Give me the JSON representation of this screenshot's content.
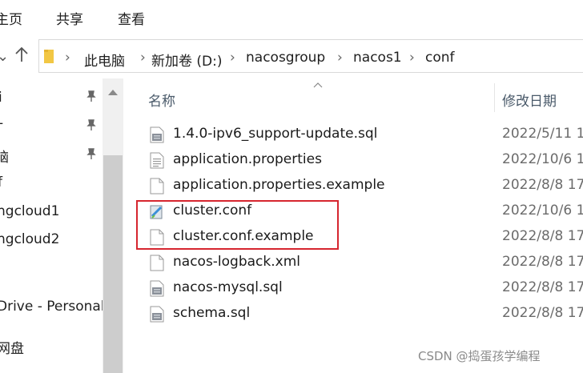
{
  "ribbon": {
    "tabs": [
      "主页",
      "共享",
      "查看"
    ]
  },
  "address": {
    "crumbs": [
      "此电脑",
      "新加卷 (D:)",
      "nacosgroup",
      "nacos1",
      "conf"
    ],
    "separator": "›"
  },
  "nav_pane": {
    "items": [
      {
        "label": "i",
        "pinned": true
      },
      {
        "label": "-",
        "pinned": true
      },
      {
        "label": "脑",
        "pinned": true
      },
      {
        "label": "f",
        "pinned": false
      },
      {
        "label": "ngcloud1",
        "pinned": false
      },
      {
        "label": "ngcloud2",
        "pinned": false
      },
      {
        "label": "",
        "pinned": false
      },
      {
        "label": "Drive - Personal",
        "pinned": false
      },
      {
        "label": "",
        "pinned": false
      },
      {
        "label": "网盘",
        "pinned": false
      }
    ]
  },
  "file_list": {
    "columns": {
      "name": "名称",
      "modified": "修改日期"
    },
    "files": [
      {
        "name": "1.4.0-ipv6_support-update.sql",
        "date": "2022/5/11 1",
        "icon": "sql-file-icon"
      },
      {
        "name": "application.properties",
        "date": "2022/10/6 1",
        "icon": "text-file-icon"
      },
      {
        "name": "application.properties.example",
        "date": "2022/8/8 17",
        "icon": "blank-file-icon"
      },
      {
        "name": "cluster.conf",
        "date": "2022/10/6 1",
        "icon": "conf-file-icon"
      },
      {
        "name": "cluster.conf.example",
        "date": "2022/8/8 17",
        "icon": "blank-file-icon"
      },
      {
        "name": "nacos-logback.xml",
        "date": "2022/8/8 17",
        "icon": "blank-file-icon"
      },
      {
        "name": "nacos-mysql.sql",
        "date": "2022/8/8 17",
        "icon": "sql-file-icon"
      },
      {
        "name": "schema.sql",
        "date": "2022/8/8 17",
        "icon": "sql-file-icon"
      }
    ]
  },
  "annotation": {
    "color": "#d6262f"
  },
  "watermark": "CSDN @捣蛋孩学编程"
}
